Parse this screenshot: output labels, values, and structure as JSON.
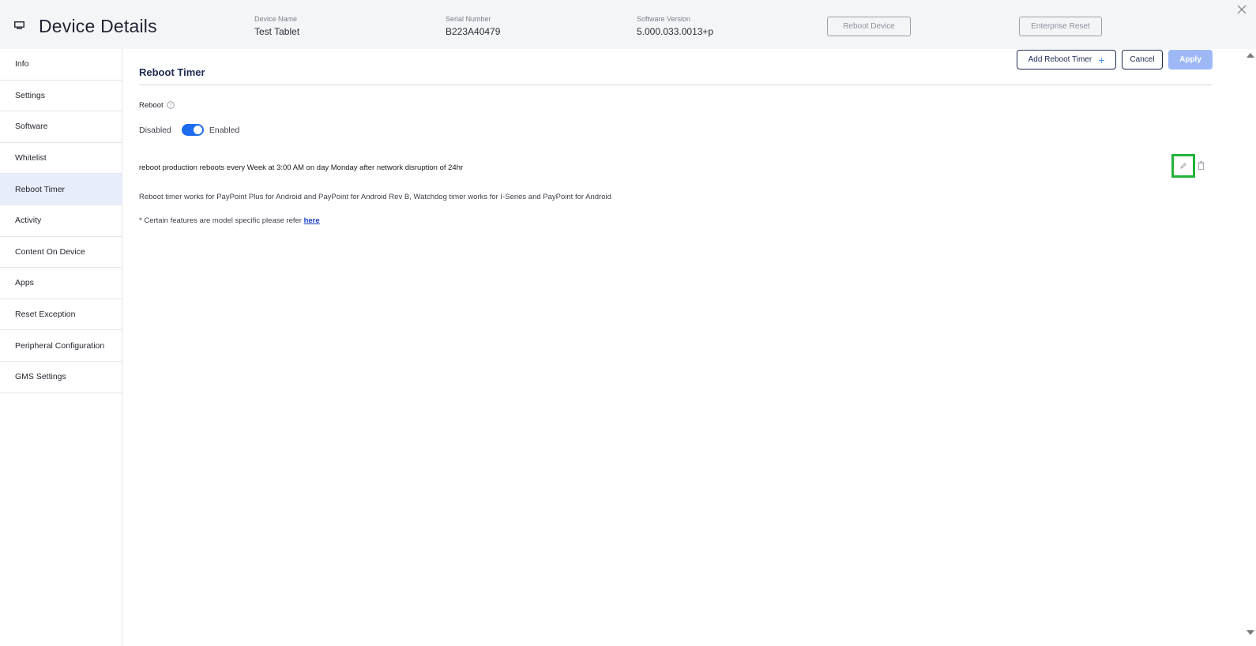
{
  "header": {
    "title": "Device Details",
    "device_name_label": "Device Name",
    "device_name": "Test Tablet",
    "serial_label": "Serial Number",
    "serial": "B223A40479",
    "software_label": "Software Version",
    "software": "5.000.033.0013+p",
    "reboot_device": "Reboot Device",
    "enterprise_reset": "Enterprise Reset"
  },
  "sidebar": {
    "items": [
      {
        "label": "Info"
      },
      {
        "label": "Settings"
      },
      {
        "label": "Software"
      },
      {
        "label": "Whitelist"
      },
      {
        "label": "Reboot Timer"
      },
      {
        "label": "Activity"
      },
      {
        "label": "Content On Device"
      },
      {
        "label": "Apps"
      },
      {
        "label": "Reset Exception"
      },
      {
        "label": "Peripheral Configuration"
      },
      {
        "label": "GMS Settings"
      }
    ],
    "active": "Reboot Timer"
  },
  "main": {
    "section_title": "Reboot Timer",
    "add_button": "Add Reboot Timer",
    "add_plus": "+",
    "cancel_button": "Cancel",
    "apply_button": "Apply",
    "reboot_label": "Reboot",
    "toggle_off_label": "Disabled",
    "toggle_on_label": "Enabled",
    "toggle_enabled": true,
    "timer_entry": "reboot production reboots every Week at 3:00 AM on day Monday after network disruption of 24hr",
    "note": "Reboot timer works for PayPoint Plus for Android and PayPoint for Android Rev B, Watchdog timer works for I-Series and PayPoint for Android",
    "footnote_prefix": "* Certain features are model specific please refer",
    "footnote_link": "here"
  },
  "colors": {
    "accent": "#1d6cf0",
    "nav_active_bg": "#e8edfb",
    "highlight_box": "#22b33a",
    "apply_disabled": "#9db8f4"
  },
  "icons": {
    "device": "monitor-icon",
    "close": "close-icon",
    "help": "help-circle-icon",
    "edit": "pencil-icon",
    "delete": "trash-icon"
  }
}
